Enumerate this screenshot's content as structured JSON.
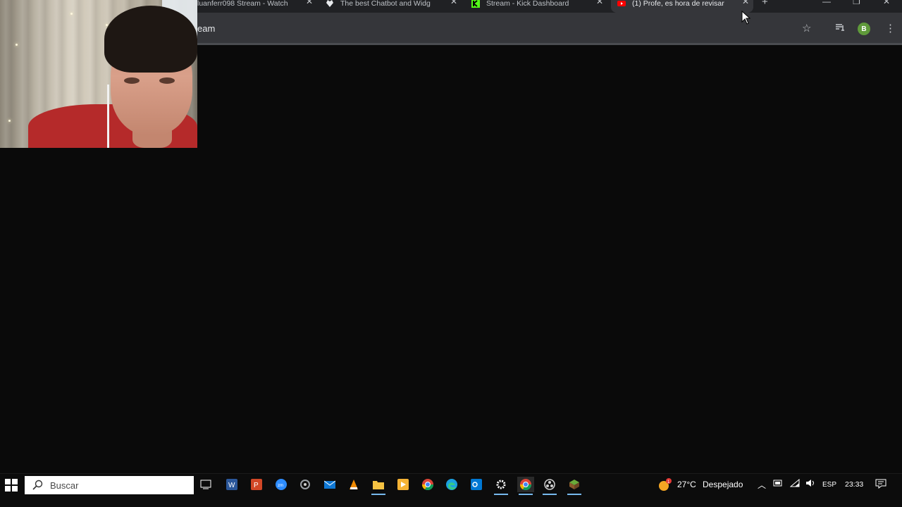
{
  "browser": {
    "tabs": [
      {
        "title": "luanferr098 Stream - Watch",
        "favicon": "play-icon",
        "active": false
      },
      {
        "title": "The best Chatbot and Widg",
        "favicon": "heart-shield-icon",
        "active": false
      },
      {
        "title": "Stream - Kick Dashboard",
        "favicon": "kick-k-icon",
        "active": false
      },
      {
        "title": "(1) Profe, es hora de revisar",
        "favicon": "youtube-icon",
        "active": true
      }
    ],
    "address_text": "eam",
    "profile_initial": "B"
  },
  "taskbar": {
    "search_placeholder": "Buscar",
    "apps": [
      "task-view-icon",
      "word-icon",
      "powerpoint-icon",
      "zoom-icon",
      "recycle-app-icon",
      "mail-icon",
      "vlc-icon",
      "file-explorer-icon",
      "media-app-icon",
      "chrome-icon",
      "edge-icon",
      "outlook-icon",
      "settings-icon",
      "chrome-active-icon",
      "obs-icon",
      "minecraft-icon"
    ],
    "weather": {
      "temp": "27°C",
      "condition": "Despejado"
    },
    "language": "ESP",
    "time": "23:33"
  },
  "colors": {
    "tab_strip": "#202124",
    "toolbar": "#35363a",
    "page_bg": "#0a0a0a",
    "taskbar": "#0c0c0c",
    "kick_green": "#53fc18",
    "youtube_red": "#ff0000"
  }
}
